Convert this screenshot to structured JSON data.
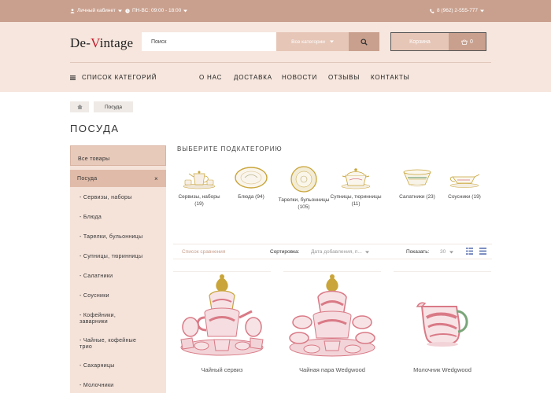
{
  "topbar": {
    "account": "Личный кабинет",
    "hours": "ПН-ВС: 09:00 - 18:00",
    "phone": "8 (962) 2-555-777"
  },
  "logo": {
    "part1": "De-",
    "accent": "V",
    "part2": "intage"
  },
  "search": {
    "placeholder": "Поиск",
    "category": "Все категории"
  },
  "cart": {
    "label": "Корзина",
    "count": "0"
  },
  "nav": {
    "categories": "СПИСОК КАТЕГОРИЙ",
    "items": [
      "О НАС",
      "ДОСТАВКА",
      "НОВОСТИ",
      "ОТЗЫВЫ",
      "КОНТАКТЫ"
    ]
  },
  "breadcrumb": {
    "current": "Посуда"
  },
  "page_title": "ПОСУДА",
  "sidebar": {
    "all": "Все товары",
    "active": "Посуда",
    "close": "×",
    "items": [
      "- Сервизы, наборы",
      "- Блюда",
      "- Тарелки, бульонницы",
      "- Супницы, тюринницы",
      "- Салатники",
      "- Соусники",
      "- Кофейники,\nзаварники",
      "- Чайные, кофейные\nтрио",
      "- Сахарницы",
      "- Молочники"
    ]
  },
  "subcategories": {
    "heading": "ВЫБЕРИТЕ ПОДКАТЕГОРИЮ",
    "items": [
      {
        "label": "Сервизы, наборы (19)",
        "icon": "tea-set-icon"
      },
      {
        "label": "Блюда (94)",
        "icon": "platter-icon"
      },
      {
        "label": "Тарелки, бульонницы (105)",
        "icon": "plate-icon"
      },
      {
        "label": "Супницы, тюринницы (11)",
        "icon": "tureen-icon"
      },
      {
        "label": "Салатники (23)",
        "icon": "salad-bowl-icon"
      },
      {
        "label": "Соусники (19)",
        "icon": "gravy-boat-icon"
      }
    ]
  },
  "sortbar": {
    "compare": "Список сравнения",
    "sort_label": "Сортировка:",
    "sort_value": "Дата добавления, п...",
    "show_label": "Показать:",
    "show_value": "30"
  },
  "products": [
    {
      "name": "Чайный сервиз",
      "image": "pink-tea-set-on-golden-stand"
    },
    {
      "name": "Чайная пара Wedgwood",
      "image": "pink-tea-set-on-golden-stand"
    },
    {
      "name": "Молочник Wedgwood",
      "image": "pink-milk-jug"
    }
  ],
  "colors": {
    "brand": "#c9a08e",
    "light": "#e6c6b7",
    "header_bg": "#f6e6dd",
    "sidebar_bg": "#f5e3da",
    "logo_accent": "#c0192a",
    "porcelain_pink": "#d97a86",
    "gold": "#c9a53a"
  }
}
